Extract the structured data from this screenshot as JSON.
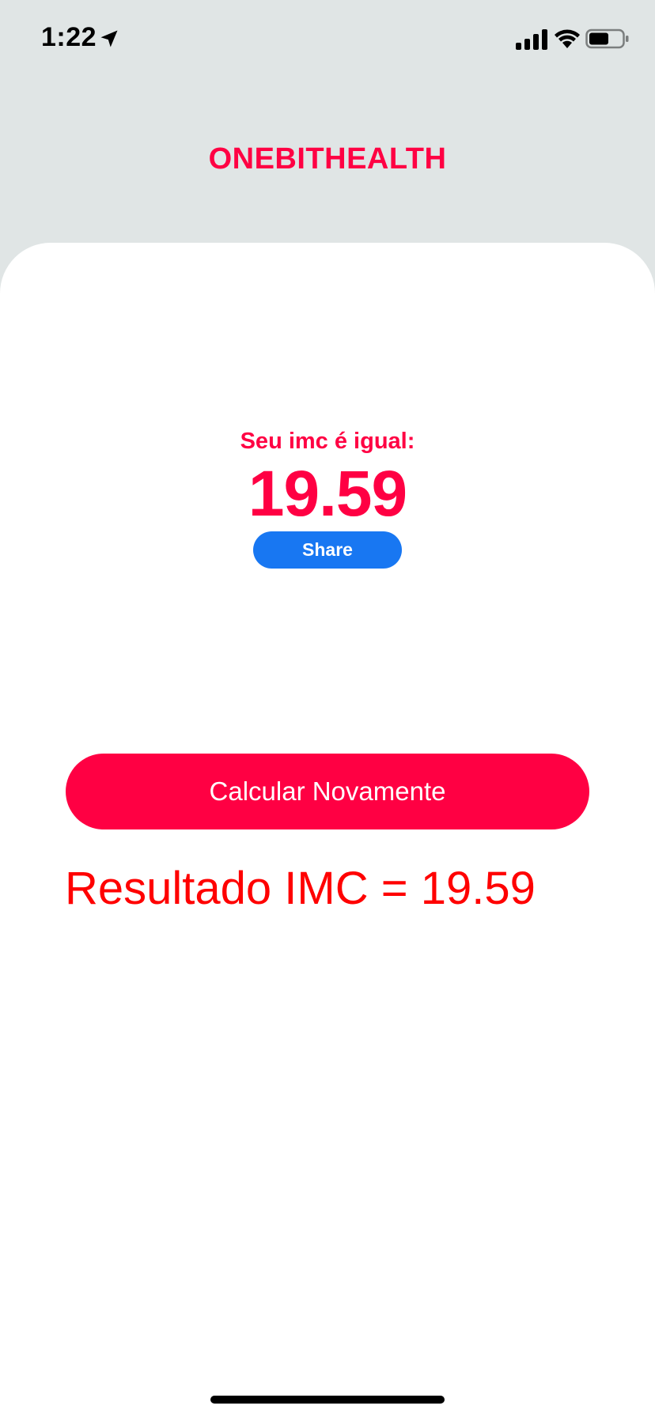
{
  "status_bar": {
    "time": "1:22",
    "icons": [
      "location-arrow-icon",
      "signal-bars-icon",
      "wifi-icon",
      "battery-icon"
    ]
  },
  "header": {
    "title": "ONEBITHEALTH"
  },
  "result_panel": {
    "label": "Seu imc é igual:",
    "value": "19.59",
    "share_label": "Share"
  },
  "actions": {
    "recalculate_label": "Calcular Novamente"
  },
  "result_text": "Resultado IMC = 19.59",
  "colors": {
    "accent": "#ff0043",
    "share_blue": "#1877f2",
    "result_red": "#ff0000",
    "header_bg": "#e0e5e5"
  }
}
